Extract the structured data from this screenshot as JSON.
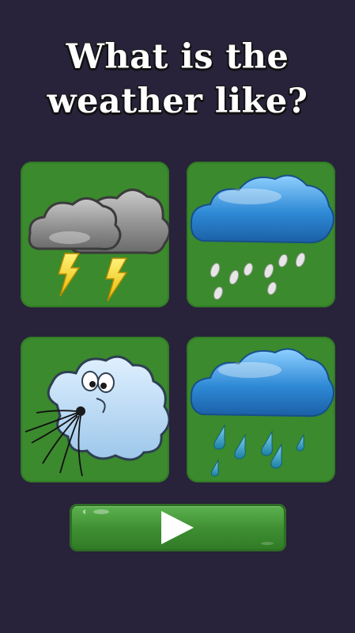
{
  "question": {
    "line1": "What is the",
    "line2": "weather like?"
  },
  "cards": [
    {
      "id": "storm",
      "icon": "thunderstorm-icon"
    },
    {
      "id": "hail",
      "icon": "hail-cloud-icon"
    },
    {
      "id": "wind",
      "icon": "wind-cloud-icon"
    },
    {
      "id": "rain",
      "icon": "rain-cloud-icon"
    }
  ],
  "play_button": {
    "icon": "play-icon"
  },
  "colors": {
    "background": "#28223a",
    "card": "#3b8a2d",
    "button": "#4a9e3e",
    "rain_cloud": "#2d86cc"
  }
}
